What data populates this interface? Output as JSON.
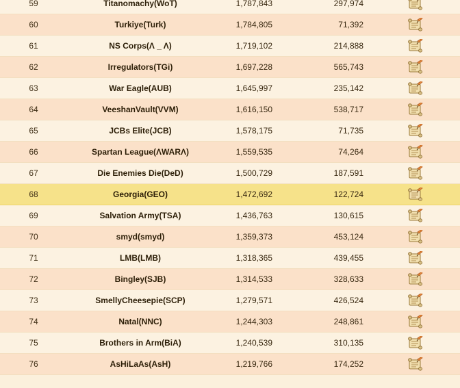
{
  "rows": [
    {
      "rank": "59",
      "name": "Titanomachy(WoT)",
      "score": "1,787,843",
      "points": "297,974",
      "icon": "scroll-icon"
    },
    {
      "rank": "60",
      "name": "Turkiye(Turk)",
      "score": "1,784,805",
      "points": "71,392",
      "icon": "scroll-icon"
    },
    {
      "rank": "61",
      "name": "NS Corps(Λ _ Λ)",
      "score": "1,719,102",
      "points": "214,888",
      "icon": "scroll-icon"
    },
    {
      "rank": "62",
      "name": "Irregulators(TGi)",
      "score": "1,697,228",
      "points": "565,743",
      "icon": "scroll-icon"
    },
    {
      "rank": "63",
      "name": "War Eagle(AUB)",
      "score": "1,645,997",
      "points": "235,142",
      "icon": "scroll-icon"
    },
    {
      "rank": "64",
      "name": "VeeshanVault(VVM)",
      "score": "1,616,150",
      "points": "538,717",
      "icon": "scroll-icon"
    },
    {
      "rank": "65",
      "name": "JCBs Elite(JCB)",
      "score": "1,578,175",
      "points": "71,735",
      "icon": "scroll-icon"
    },
    {
      "rank": "66",
      "name": "Spartan League(ΛWARΛ)",
      "score": "1,559,535",
      "points": "74,264",
      "icon": "scroll-icon"
    },
    {
      "rank": "67",
      "name": "Die Enemies Die(DeD)",
      "score": "1,500,729",
      "points": "187,591",
      "icon": "scroll-icon"
    },
    {
      "rank": "68",
      "name": "Georgia(GEO)",
      "score": "1,472,692",
      "points": "122,724",
      "icon": "scroll-icon",
      "highlighted": true
    },
    {
      "rank": "69",
      "name": "Salvation Army(TSA)",
      "score": "1,436,763",
      "points": "130,615",
      "icon": "scroll-icon"
    },
    {
      "rank": "70",
      "name": "smyd(smyd)",
      "score": "1,359,373",
      "points": "453,124",
      "icon": "scroll-icon"
    },
    {
      "rank": "71",
      "name": "LMB(LMB)",
      "score": "1,318,365",
      "points": "439,455",
      "icon": "scroll-icon"
    },
    {
      "rank": "72",
      "name": "Bingley(SJB)",
      "score": "1,314,533",
      "points": "328,633",
      "icon": "scroll-icon"
    },
    {
      "rank": "73",
      "name": "SmellyCheesepie(SCP)",
      "score": "1,279,571",
      "points": "426,524",
      "icon": "scroll-icon"
    },
    {
      "rank": "74",
      "name": "Natal(NNC)",
      "score": "1,244,303",
      "points": "248,861",
      "icon": "scroll-icon"
    },
    {
      "rank": "75",
      "name": "Brothers in Arm(BiA)",
      "score": "1,240,539",
      "points": "310,135",
      "icon": "scroll-icon"
    },
    {
      "rank": "76",
      "name": "AsHiLaAs(AsH)",
      "score": "1,219,766",
      "points": "174,252",
      "icon": "scroll-icon"
    }
  ],
  "colors": {
    "row_odd": "#fcf2e1",
    "row_even": "#fbe1c9",
    "row_highlight": "#f6e28a",
    "text": "#2d1f08"
  }
}
